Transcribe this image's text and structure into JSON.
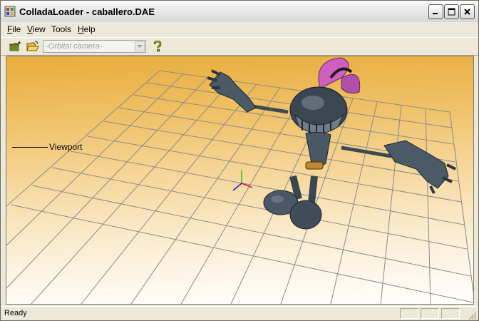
{
  "window": {
    "title": "ColladaLoader - caballero.DAE"
  },
  "menu": {
    "items": [
      {
        "underline": "F",
        "rest": "ile"
      },
      {
        "underline": "V",
        "rest": "iew"
      },
      {
        "underline": "",
        "rest": "Tools"
      },
      {
        "underline": "H",
        "rest": "elp"
      }
    ]
  },
  "toolbar": {
    "open_icon": "folder-new-icon",
    "open_file_icon": "folder-open-icon",
    "camera_select": {
      "value": "-Orbital camera-"
    },
    "help_icon": "help-question-icon"
  },
  "viewport": {
    "label": "Viewport",
    "background_colors": [
      "#e8ad3d",
      "#ffffff"
    ]
  },
  "statusbar": {
    "text": "Ready"
  }
}
